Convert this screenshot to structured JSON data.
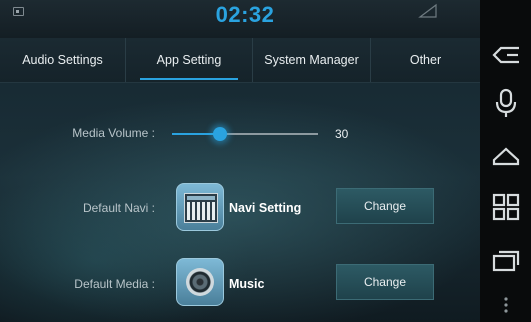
{
  "status": {
    "clock": "02:32"
  },
  "tabs": [
    {
      "label": "Audio Settings",
      "active": false
    },
    {
      "label": "App Setting",
      "active": true
    },
    {
      "label": "System Manager",
      "active": false
    },
    {
      "label": "Other",
      "active": false
    }
  ],
  "media_volume": {
    "label": "Media Volume :",
    "value": "30",
    "level": 0.33
  },
  "default_navi": {
    "label": "Default Navi :",
    "app_name": "Navi Setting",
    "icon": "navi-app-icon",
    "button_label": "Change"
  },
  "default_media": {
    "label": "Default Media :",
    "app_name": "Music",
    "icon": "music-app-icon",
    "button_label": "Change"
  },
  "sidebar": {
    "icons": [
      "back-icon",
      "mic-icon",
      "home-icon",
      "apps-icon",
      "recents-icon",
      "more-icon"
    ]
  },
  "colors": {
    "accent": "#2aa3e0",
    "background": "#15262f",
    "sidebar": "#090b0c"
  }
}
